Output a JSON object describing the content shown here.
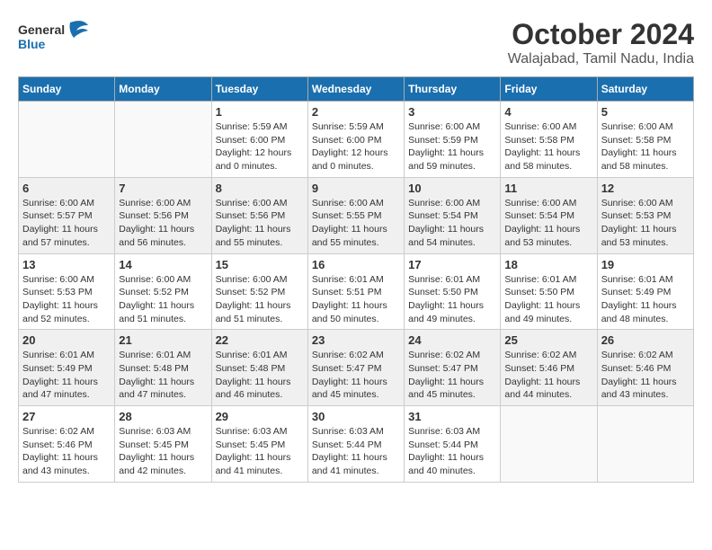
{
  "logo": {
    "line1": "General",
    "line2": "Blue"
  },
  "title": "October 2024",
  "location": "Walajabad, Tamil Nadu, India",
  "days_of_week": [
    "Sunday",
    "Monday",
    "Tuesday",
    "Wednesday",
    "Thursday",
    "Friday",
    "Saturday"
  ],
  "weeks": [
    [
      {
        "day": "",
        "info": ""
      },
      {
        "day": "",
        "info": ""
      },
      {
        "day": "1",
        "info": "Sunrise: 5:59 AM\nSunset: 6:00 PM\nDaylight: 12 hours\nand 0 minutes."
      },
      {
        "day": "2",
        "info": "Sunrise: 5:59 AM\nSunset: 6:00 PM\nDaylight: 12 hours\nand 0 minutes."
      },
      {
        "day": "3",
        "info": "Sunrise: 6:00 AM\nSunset: 5:59 PM\nDaylight: 11 hours\nand 59 minutes."
      },
      {
        "day": "4",
        "info": "Sunrise: 6:00 AM\nSunset: 5:58 PM\nDaylight: 11 hours\nand 58 minutes."
      },
      {
        "day": "5",
        "info": "Sunrise: 6:00 AM\nSunset: 5:58 PM\nDaylight: 11 hours\nand 58 minutes."
      }
    ],
    [
      {
        "day": "6",
        "info": "Sunrise: 6:00 AM\nSunset: 5:57 PM\nDaylight: 11 hours\nand 57 minutes."
      },
      {
        "day": "7",
        "info": "Sunrise: 6:00 AM\nSunset: 5:56 PM\nDaylight: 11 hours\nand 56 minutes."
      },
      {
        "day": "8",
        "info": "Sunrise: 6:00 AM\nSunset: 5:56 PM\nDaylight: 11 hours\nand 55 minutes."
      },
      {
        "day": "9",
        "info": "Sunrise: 6:00 AM\nSunset: 5:55 PM\nDaylight: 11 hours\nand 55 minutes."
      },
      {
        "day": "10",
        "info": "Sunrise: 6:00 AM\nSunset: 5:54 PM\nDaylight: 11 hours\nand 54 minutes."
      },
      {
        "day": "11",
        "info": "Sunrise: 6:00 AM\nSunset: 5:54 PM\nDaylight: 11 hours\nand 53 minutes."
      },
      {
        "day": "12",
        "info": "Sunrise: 6:00 AM\nSunset: 5:53 PM\nDaylight: 11 hours\nand 53 minutes."
      }
    ],
    [
      {
        "day": "13",
        "info": "Sunrise: 6:00 AM\nSunset: 5:53 PM\nDaylight: 11 hours\nand 52 minutes."
      },
      {
        "day": "14",
        "info": "Sunrise: 6:00 AM\nSunset: 5:52 PM\nDaylight: 11 hours\nand 51 minutes."
      },
      {
        "day": "15",
        "info": "Sunrise: 6:00 AM\nSunset: 5:52 PM\nDaylight: 11 hours\nand 51 minutes."
      },
      {
        "day": "16",
        "info": "Sunrise: 6:01 AM\nSunset: 5:51 PM\nDaylight: 11 hours\nand 50 minutes."
      },
      {
        "day": "17",
        "info": "Sunrise: 6:01 AM\nSunset: 5:50 PM\nDaylight: 11 hours\nand 49 minutes."
      },
      {
        "day": "18",
        "info": "Sunrise: 6:01 AM\nSunset: 5:50 PM\nDaylight: 11 hours\nand 49 minutes."
      },
      {
        "day": "19",
        "info": "Sunrise: 6:01 AM\nSunset: 5:49 PM\nDaylight: 11 hours\nand 48 minutes."
      }
    ],
    [
      {
        "day": "20",
        "info": "Sunrise: 6:01 AM\nSunset: 5:49 PM\nDaylight: 11 hours\nand 47 minutes."
      },
      {
        "day": "21",
        "info": "Sunrise: 6:01 AM\nSunset: 5:48 PM\nDaylight: 11 hours\nand 47 minutes."
      },
      {
        "day": "22",
        "info": "Sunrise: 6:01 AM\nSunset: 5:48 PM\nDaylight: 11 hours\nand 46 minutes."
      },
      {
        "day": "23",
        "info": "Sunrise: 6:02 AM\nSunset: 5:47 PM\nDaylight: 11 hours\nand 45 minutes."
      },
      {
        "day": "24",
        "info": "Sunrise: 6:02 AM\nSunset: 5:47 PM\nDaylight: 11 hours\nand 45 minutes."
      },
      {
        "day": "25",
        "info": "Sunrise: 6:02 AM\nSunset: 5:46 PM\nDaylight: 11 hours\nand 44 minutes."
      },
      {
        "day": "26",
        "info": "Sunrise: 6:02 AM\nSunset: 5:46 PM\nDaylight: 11 hours\nand 43 minutes."
      }
    ],
    [
      {
        "day": "27",
        "info": "Sunrise: 6:02 AM\nSunset: 5:46 PM\nDaylight: 11 hours\nand 43 minutes."
      },
      {
        "day": "28",
        "info": "Sunrise: 6:03 AM\nSunset: 5:45 PM\nDaylight: 11 hours\nand 42 minutes."
      },
      {
        "day": "29",
        "info": "Sunrise: 6:03 AM\nSunset: 5:45 PM\nDaylight: 11 hours\nand 41 minutes."
      },
      {
        "day": "30",
        "info": "Sunrise: 6:03 AM\nSunset: 5:44 PM\nDaylight: 11 hours\nand 41 minutes."
      },
      {
        "day": "31",
        "info": "Sunrise: 6:03 AM\nSunset: 5:44 PM\nDaylight: 11 hours\nand 40 minutes."
      },
      {
        "day": "",
        "info": ""
      },
      {
        "day": "",
        "info": ""
      }
    ]
  ]
}
